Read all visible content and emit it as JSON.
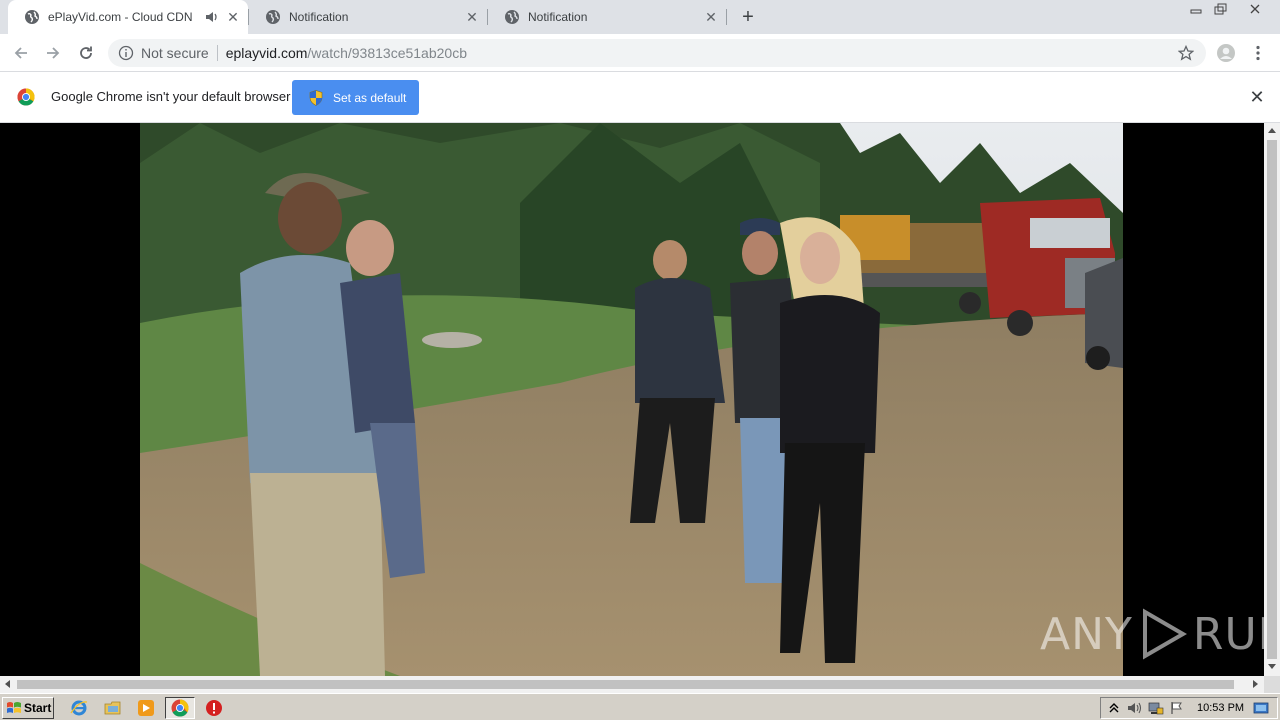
{
  "tabs": [
    {
      "title": "ePlayVid.com - Cloud CDN",
      "active": true,
      "audio": true
    },
    {
      "title": "Notification",
      "active": false
    },
    {
      "title": "Notification",
      "active": false
    }
  ],
  "address": {
    "security_label": "Not secure",
    "host": "eplayvid.com",
    "path": "/watch/93813ce51ab20cb"
  },
  "infobar": {
    "message": "Google Chrome isn't your default browser",
    "button_label": "Set as default"
  },
  "watermark": {
    "left": "ANY",
    "right": "RUN"
  },
  "taskbar": {
    "start_label": "Start",
    "clock": "10:53 PM"
  },
  "colors": {
    "tab_strip": "#dee1e6",
    "accent_button": "#4a8ef0",
    "taskbar": "#d4d0c8"
  }
}
